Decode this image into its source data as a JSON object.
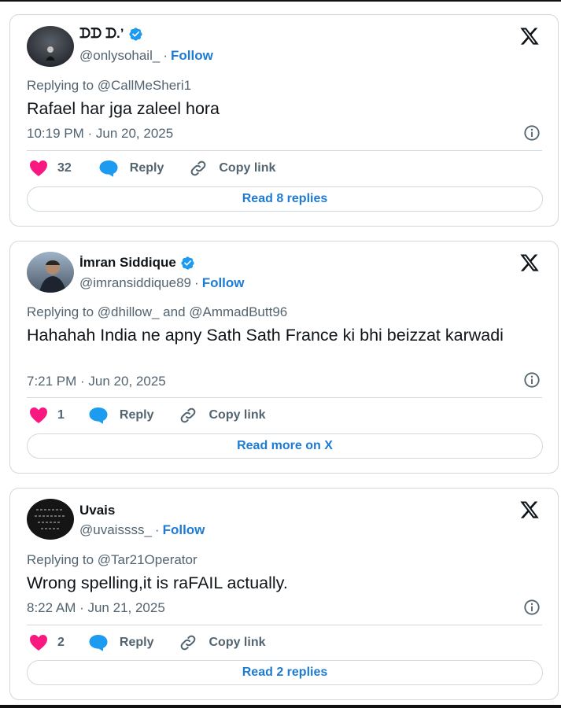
{
  "colors": {
    "accent": "#1d9bf0",
    "heart": "#f91880",
    "muted": "#536471",
    "border": "#cfd9de"
  },
  "tweets": [
    {
      "name": "ᗪᗪ ᗪ.’",
      "verified": true,
      "handle": "@onlysohail_",
      "follow_label": "Follow",
      "replying_to": "Replying to @CallMeSheri1",
      "text": "Rafael har jga zaleel hora",
      "time": "10:19 PM · Jun 20, 2025",
      "likes": "32",
      "reply_label": "Reply",
      "copy_label": "Copy link",
      "read_label": "Read 8 replies"
    },
    {
      "name": "İmran Siddique",
      "verified": true,
      "handle": "@imransiddique89",
      "follow_label": "Follow",
      "replying_to": "Replying to @dhillow_ and @AmmadButt96",
      "text": "Hahahah India ne apny Sath Sath France ki bhi beizzat karwadi",
      "time": "7:21 PM · Jun 20, 2025",
      "likes": "1",
      "reply_label": "Reply",
      "copy_label": "Copy link",
      "read_label": "Read more on X"
    },
    {
      "name": "Uvais",
      "verified": false,
      "handle": "@uvaissss_",
      "follow_label": "Follow",
      "replying_to": "Replying to @Tar21Operator",
      "text": "Wrong spelling,it is raFAIL actually.",
      "time": "8:22 AM · Jun 21, 2025",
      "likes": "2",
      "reply_label": "Reply",
      "copy_label": "Copy link",
      "read_label": "Read 2 replies"
    }
  ]
}
